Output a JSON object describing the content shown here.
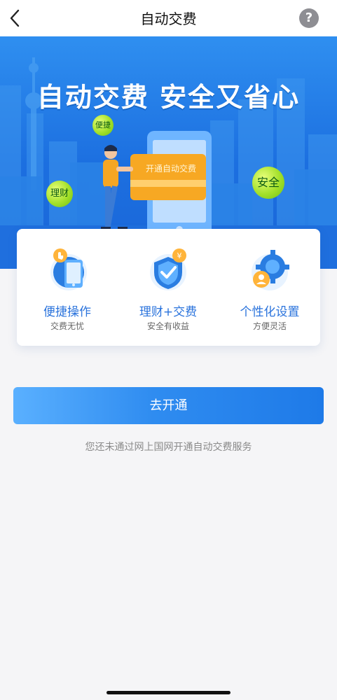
{
  "header": {
    "title": "自动交费",
    "help_label": "?"
  },
  "banner": {
    "slogan": "自动交费 安全又省心",
    "card_text": "开通自动交费",
    "bubbles": {
      "safe": "安全",
      "convenient": "便捷",
      "finance": "理财"
    }
  },
  "features": [
    {
      "title": "便捷操作",
      "subtitle": "交费无忧",
      "icon": "phone-hand-icon"
    },
    {
      "title": "理财+交费",
      "subtitle": "安全有收益",
      "icon": "shield-check-yuan-icon"
    },
    {
      "title": "个性化设置",
      "subtitle": "方便灵活",
      "icon": "gear-person-icon"
    }
  ],
  "action": {
    "button_label": "去开通",
    "notice": "您还未通过网上国网开通自动交费服务"
  },
  "colors": {
    "accent": "#2a73dc",
    "button_gradient_start": "#5ab0ff",
    "button_gradient_end": "#1e7ae8",
    "banner_blue": "#1c6fe0",
    "bubble_green": "#a3e02a"
  }
}
